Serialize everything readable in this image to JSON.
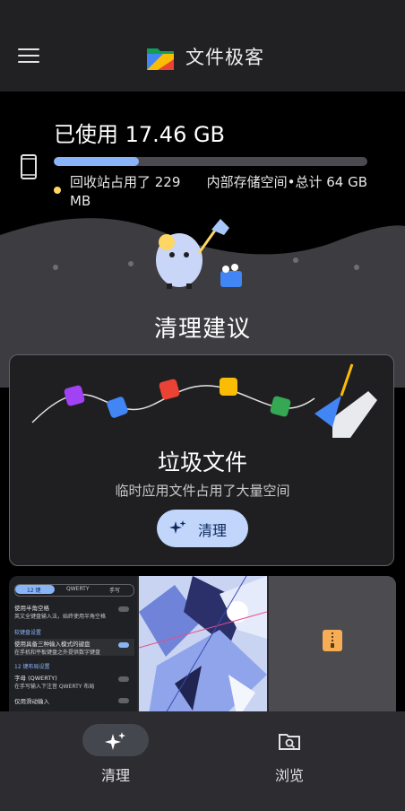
{
  "app": {
    "title": "文件极客"
  },
  "storage": {
    "used_label": "已使用 17.46 GB",
    "used_fraction": 0.27,
    "recycle_bin_text": "回收站占用了 229 MB",
    "total_text": "内部存储空间•总计 64 GB"
  },
  "suggestions": {
    "title": "清理建议",
    "junk_card": {
      "title": "垃圾文件",
      "subtitle": "临时应用文件占用了大量空间",
      "button_label": "清理"
    }
  },
  "media_preview": {
    "settings_tabs": [
      "12 键",
      "QWERTY",
      "手写"
    ],
    "settings_rows": [
      {
        "title": "使用半角空格",
        "desc": "英文全键盘输入法，始终使用半角空格"
      },
      {
        "title": "使用具备三种输入模式的键盘",
        "desc": "在手机和平板键盘之外提供数字键盘"
      },
      {
        "title": "字母 (QWERTY)",
        "desc": "在手写输入下注音 QWERTY 布局"
      },
      {
        "title": "仅用滑动输入",
        "desc": ""
      }
    ],
    "settings_headers": [
      "软键盘设置",
      "12 键布局设置"
    ]
  },
  "bottom_nav": {
    "items": [
      {
        "label": "清理",
        "icon": "sparkle-icon",
        "selected": true
      },
      {
        "label": "浏览",
        "icon": "browse-icon",
        "selected": false
      }
    ]
  },
  "colors": {
    "accent": "#8ab4f8",
    "button_bg": "#c2d6fc",
    "bin_dot": "#fdd663",
    "nav_bg": "#2c2c31"
  }
}
